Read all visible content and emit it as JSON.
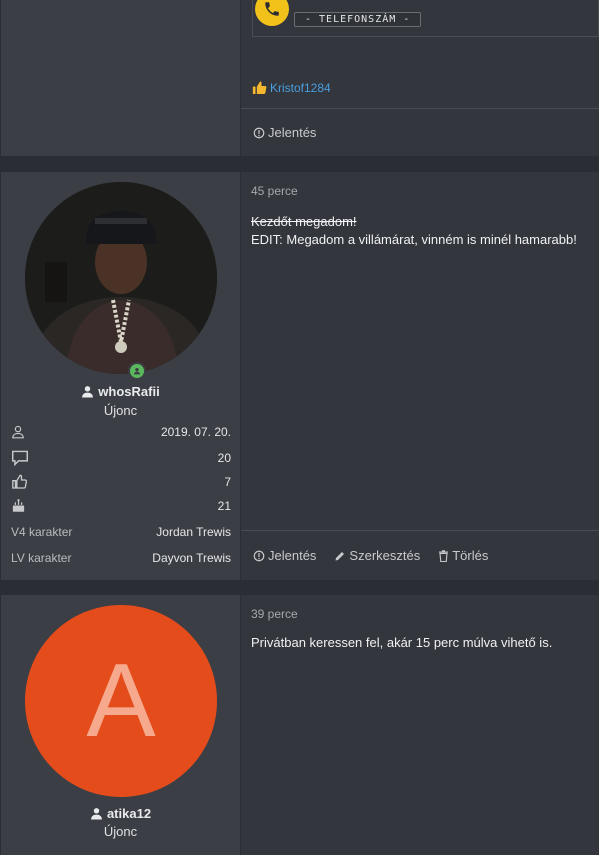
{
  "post_prev": {
    "badge_label": "- TELEFONSZÁM -",
    "liker": "Kristof1284",
    "actions": {
      "report": "Jelentés"
    }
  },
  "post_rafii": {
    "time": "45 perce",
    "struck_line": "Kezdőt megadom!",
    "edit_line": "EDIT: Megadom a villámárat, vinném is minél hamarabb!",
    "username": "whosRafii",
    "role": "Újonc",
    "stats": [
      {
        "icon": "user-icon",
        "value": "2019. 07. 20."
      },
      {
        "icon": "message-icon",
        "value": "20"
      },
      {
        "icon": "thumbs-up-icon",
        "value": "7"
      },
      {
        "icon": "cake-icon",
        "value": "21"
      }
    ],
    "fields": [
      {
        "label": "V4 karakter",
        "value": "Jordan Trewis"
      },
      {
        "label": "LV karakter",
        "value": "Dayvon Trewis"
      }
    ],
    "actions": {
      "report": "Jelentés",
      "edit": "Szerkesztés",
      "delete": "Törlés"
    }
  },
  "post_atika": {
    "time": "39 perce",
    "content": "Privátban keressen fel, akár 15 perc múlva vihető is.",
    "avatar_letter": "A",
    "username": "atika12",
    "role": "Újonc"
  },
  "colors": {
    "page_bg": "#2a2d33",
    "panel_bg": "#33363c",
    "sidebar_bg": "#3b3e44",
    "link": "#4a9fe0",
    "avatar_orange": "#e44d1b",
    "avatar_letter": "#f6a98c",
    "online_green": "#5cb85c"
  }
}
